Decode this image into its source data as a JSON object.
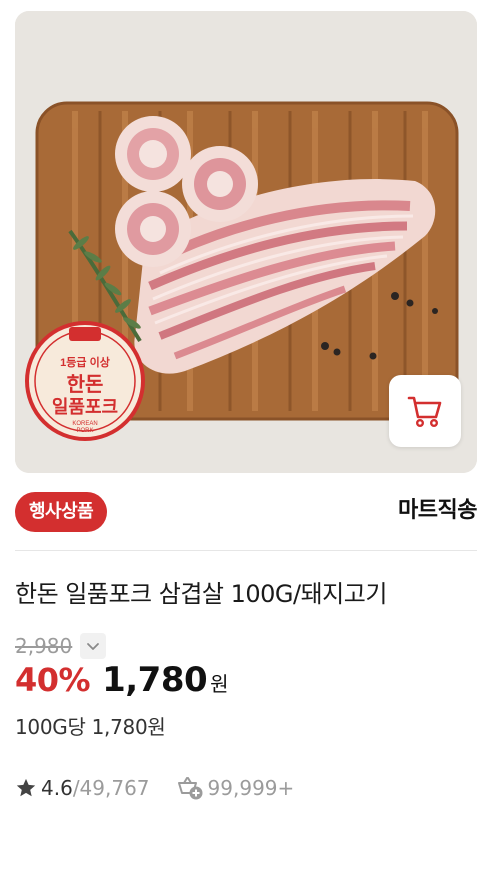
{
  "product": {
    "image_label": {
      "top": "1등급 이상",
      "main_line1": "한돈",
      "main_line2": "일품포크",
      "bottom_line1": "KOREAN",
      "bottom_line2": "PORK"
    },
    "badge": "행사상품",
    "shipping": "마트직송",
    "title": "한돈 일품포크 삼겹살 100G/돼지고기",
    "original_price": "2,980",
    "discount": "40%",
    "sale_price": "1,780",
    "currency": "원",
    "unit_price": "100G당 1,780원",
    "rating": "4.6",
    "review_count": "/49,767",
    "sold_count": "99,999+"
  },
  "icons": {
    "cart": "cart-icon",
    "toggle": "chevron-down-icon",
    "star": "star-icon",
    "sold": "basket-plus-icon"
  },
  "colors": {
    "accent": "#d32f2f",
    "muted": "#9b9b9b",
    "text": "#111111"
  }
}
